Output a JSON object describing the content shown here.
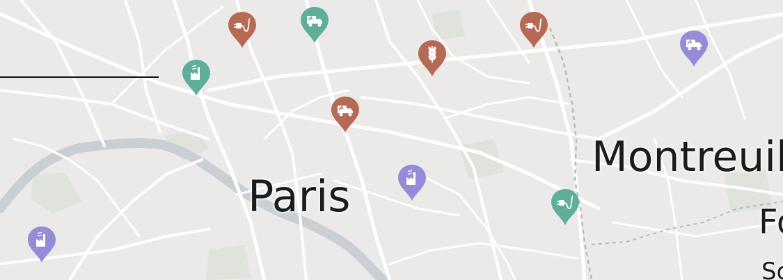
{
  "map": {
    "labels": {
      "paris": "Paris",
      "montreuil": "Montreuil",
      "partial_1": "Fo",
      "partial_2": "So"
    },
    "colors": {
      "land": "#ebeae8",
      "road": "#ffffff",
      "river": "#c9cfd3",
      "park": "#dfe3dc",
      "boundary": "#b9b9b9"
    },
    "category_colors": {
      "orange": "#b56a55",
      "green": "#5fae9a",
      "purple": "#948cd9"
    },
    "markers": [
      {
        "id": "m1",
        "icon": "electric-plug-icon",
        "color": "#b56a55"
      },
      {
        "id": "m2",
        "icon": "delivery-truck-icon",
        "color": "#5fae9a"
      },
      {
        "id": "m3",
        "icon": "factory-icon",
        "color": "#5fae9a"
      },
      {
        "id": "m4",
        "icon": "wheat-icon",
        "color": "#b56a55"
      },
      {
        "id": "m5",
        "icon": "electric-plug-icon",
        "color": "#b56a55"
      },
      {
        "id": "m6",
        "icon": "delivery-truck-icon",
        "color": "#948cd9"
      },
      {
        "id": "m7",
        "icon": "delivery-truck-icon",
        "color": "#b56a55"
      },
      {
        "id": "m8",
        "icon": "factory-icon",
        "color": "#948cd9"
      },
      {
        "id": "m9",
        "icon": "electric-plug-icon",
        "color": "#5fae9a"
      },
      {
        "id": "m10",
        "icon": "factory-icon",
        "color": "#948cd9"
      }
    ]
  }
}
